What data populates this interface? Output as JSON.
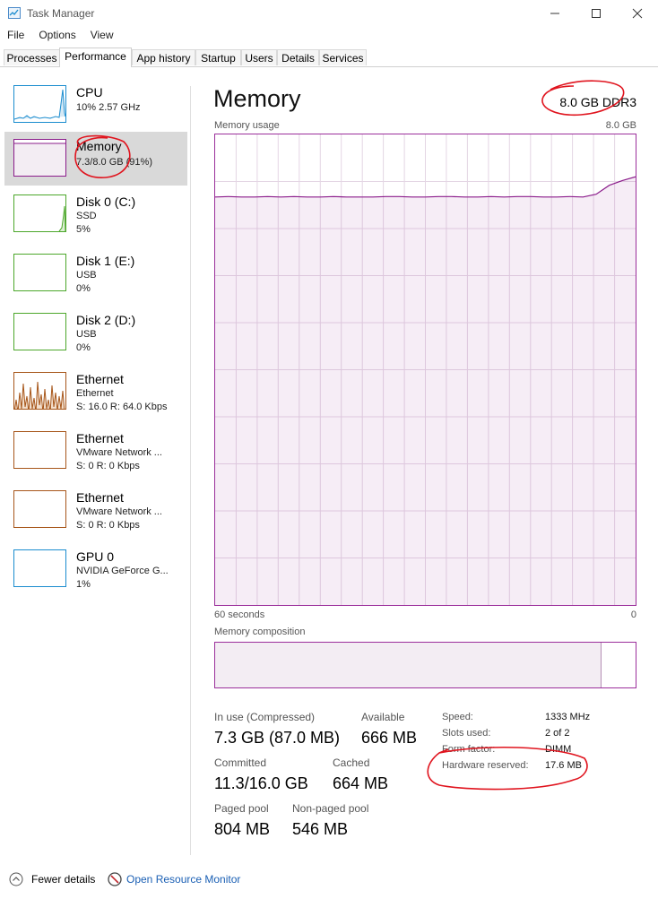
{
  "window": {
    "title": "Task Manager"
  },
  "menu": [
    "File",
    "Options",
    "View"
  ],
  "tabs": [
    "Processes",
    "Performance",
    "App history",
    "Startup",
    "Users",
    "Details",
    "Services"
  ],
  "sidebar": [
    {
      "title": "CPU",
      "line1": "10%  2.57 GHz",
      "line2": "",
      "color": "#1a8ccf"
    },
    {
      "title": "Memory",
      "line1": "7.3/8.0 GB (91%)",
      "line2": "",
      "color": "#8b1c8b"
    },
    {
      "title": "Disk 0 (C:)",
      "line1": "SSD",
      "line2": "5%",
      "color": "#4ca72a"
    },
    {
      "title": "Disk 1 (E:)",
      "line1": "USB",
      "line2": "0%",
      "color": "#4ca72a"
    },
    {
      "title": "Disk 2 (D:)",
      "line1": "USB",
      "line2": "0%",
      "color": "#4ca72a"
    },
    {
      "title": "Ethernet",
      "line1": "Ethernet",
      "line2": "S: 16.0  R: 64.0 Kbps",
      "color": "#a7561a"
    },
    {
      "title": "Ethernet",
      "line1": "VMware Network ...",
      "line2": "S: 0  R: 0 Kbps",
      "color": "#a7561a"
    },
    {
      "title": "Ethernet",
      "line1": "VMware Network ...",
      "line2": "S: 0  R: 0 Kbps",
      "color": "#a7561a"
    },
    {
      "title": "GPU 0",
      "line1": "NVIDIA GeForce G...",
      "line2": "1%",
      "color": "#1a8ccf"
    }
  ],
  "header": {
    "title": "Memory",
    "spec": "8.0 GB DDR3"
  },
  "usage_graph": {
    "label": "Memory usage",
    "max_label": "8.0 GB",
    "left_axis": "60 seconds",
    "right_axis": "0",
    "usage_fraction": [
      0.867,
      0.868,
      0.867,
      0.867,
      0.868,
      0.867,
      0.868,
      0.867,
      0.867,
      0.868,
      0.867,
      0.867,
      0.867,
      0.868,
      0.868,
      0.867,
      0.867,
      0.868,
      0.868,
      0.867,
      0.867,
      0.868,
      0.867,
      0.868,
      0.868,
      0.867,
      0.867,
      0.868,
      0.867,
      0.873,
      0.892,
      0.902,
      0.91
    ]
  },
  "composition": {
    "label": "Memory composition",
    "in_use_fraction": 0.92
  },
  "stats": [
    {
      "label": "In use (Compressed)",
      "value": "7.3 GB (87.0 MB)"
    },
    {
      "label": "Available",
      "value": "666 MB"
    },
    {
      "label": "Committed",
      "value": "11.3/16.0 GB"
    },
    {
      "label": "Cached",
      "value": "664 MB"
    },
    {
      "label": "Paged pool",
      "value": "804 MB"
    },
    {
      "label": "Non-paged pool",
      "value": "546 MB"
    }
  ],
  "details": [
    {
      "label": "Speed:",
      "value": "1333 MHz"
    },
    {
      "label": "Slots used:",
      "value": "2 of 2"
    },
    {
      "label": "Form factor:",
      "value": "DIMM"
    },
    {
      "label": "Hardware reserved:",
      "value": "17.6 MB"
    }
  ],
  "footer": {
    "fewer_details": "Fewer details",
    "resource_monitor": "Open Resource Monitor"
  },
  "colors": {
    "memory": "#8b1c8b",
    "annotation": "#e0141e",
    "link": "#1a5fb4"
  }
}
